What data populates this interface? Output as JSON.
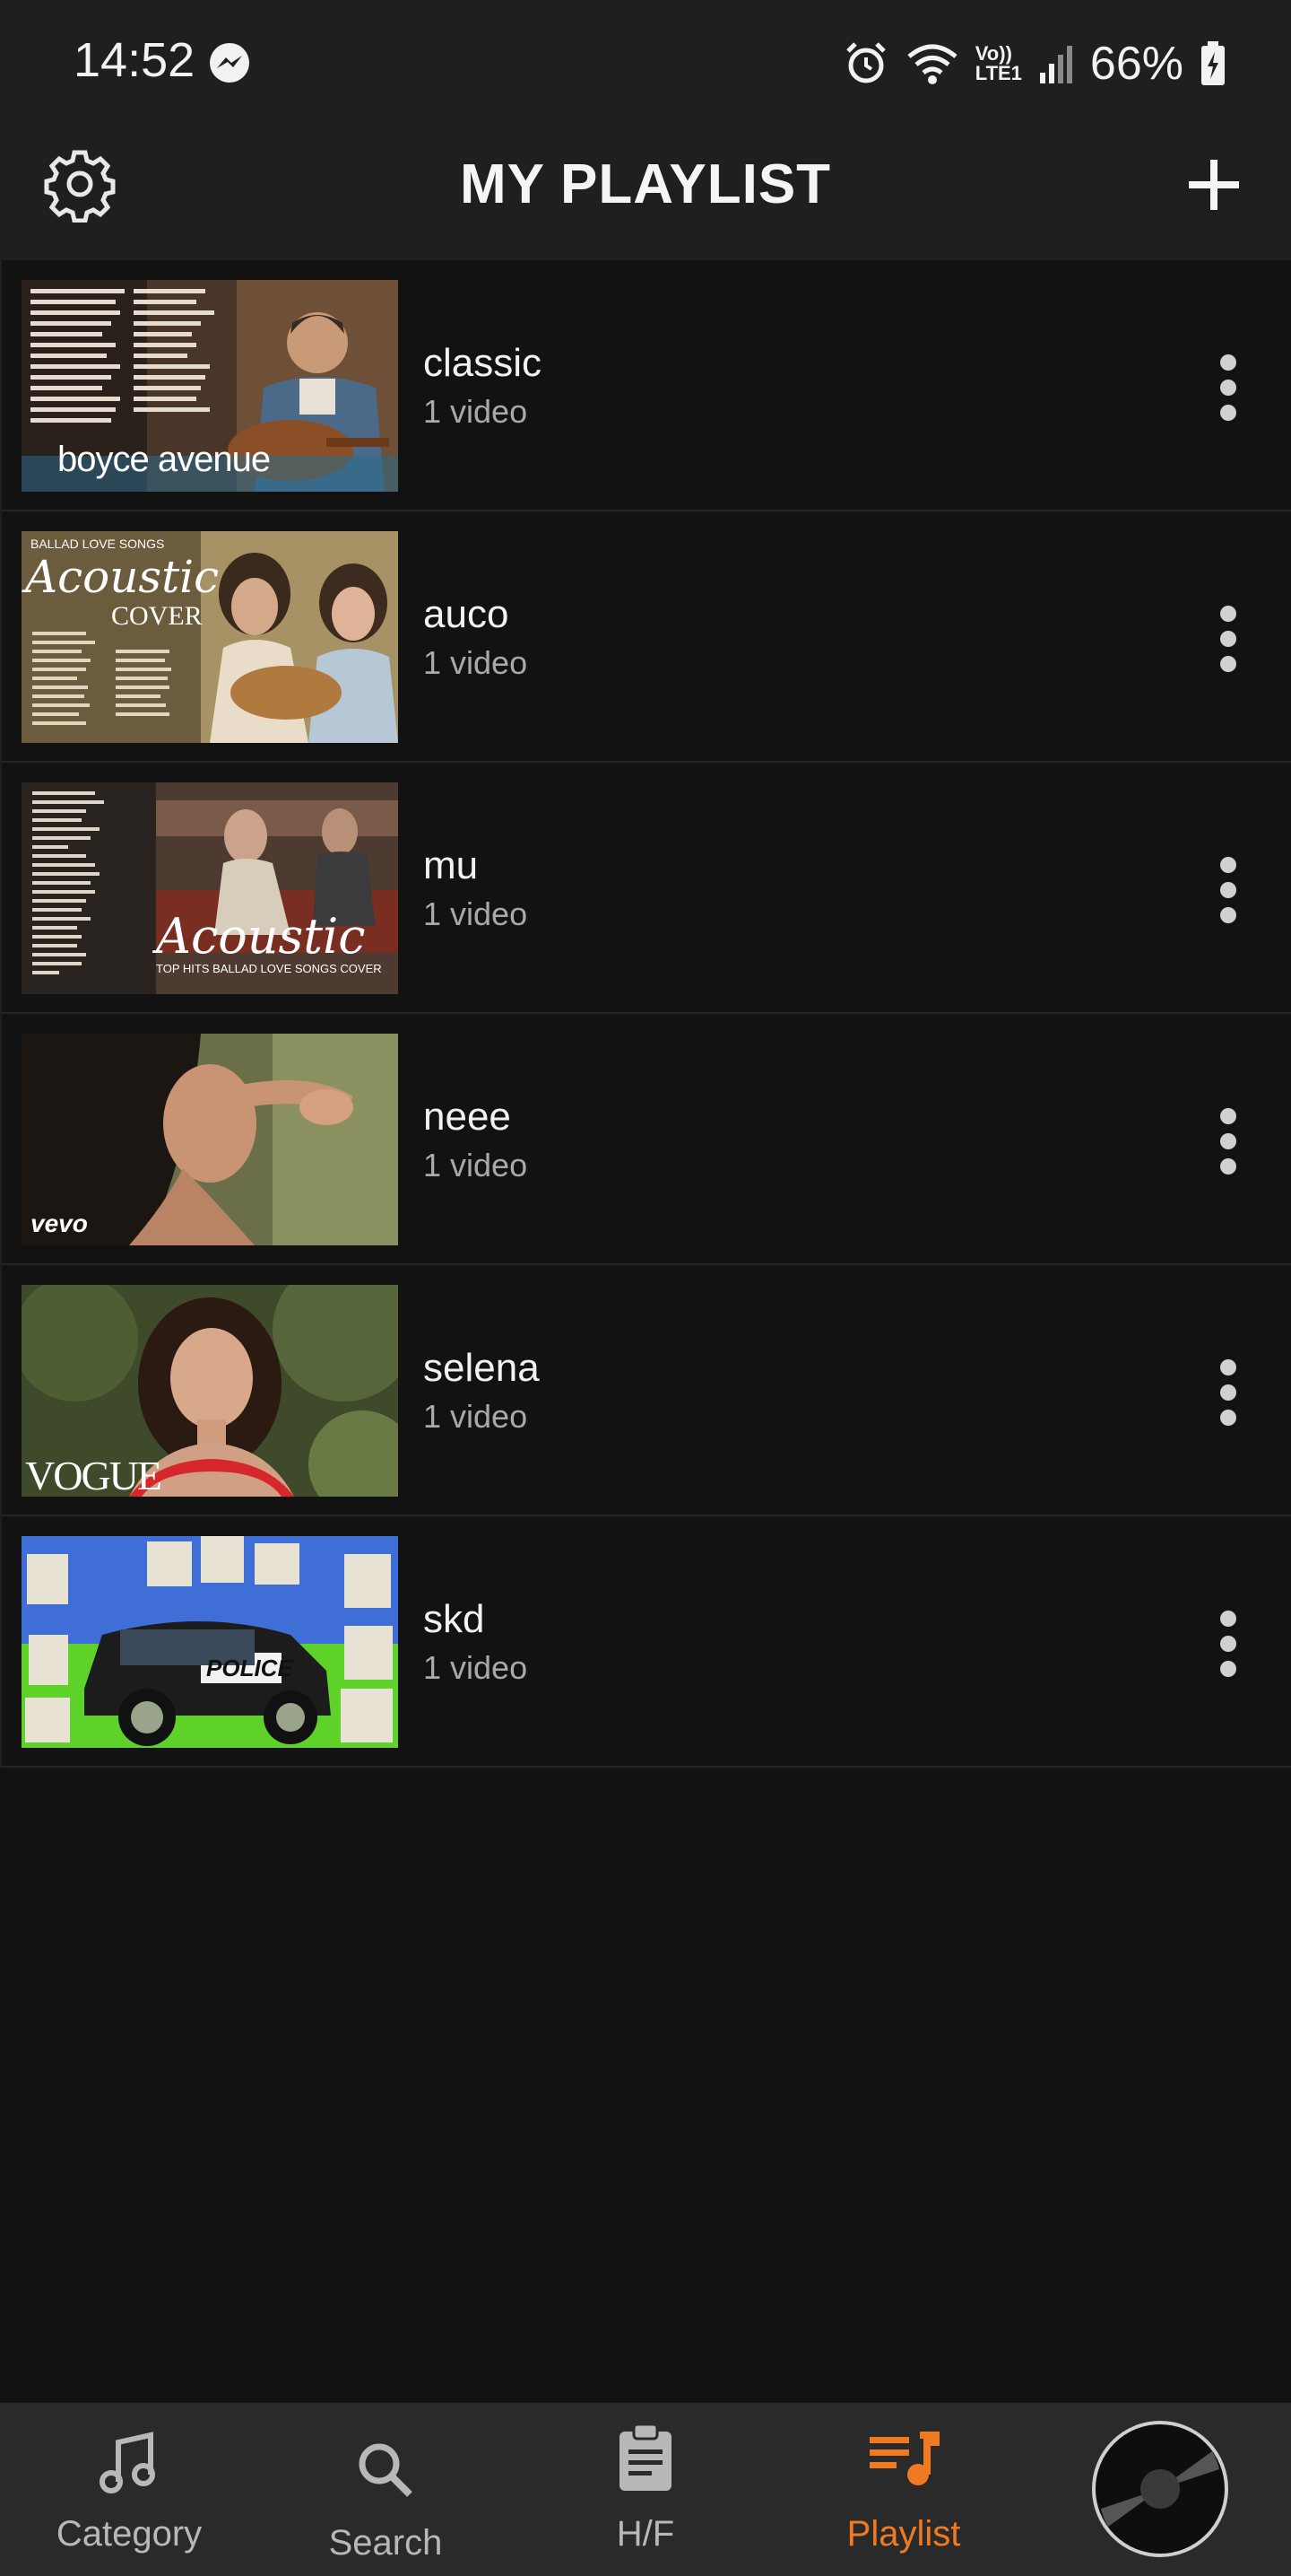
{
  "status_bar": {
    "time": "14:52",
    "battery": "66%",
    "network_label_top": "Vo))",
    "network_label_bottom": "LTE1"
  },
  "header": {
    "title": "MY PLAYLIST"
  },
  "playlists": [
    {
      "name": "classic",
      "count": "1 video",
      "thumb_text": "boyce avenue"
    },
    {
      "name": "auco",
      "count": "1 video",
      "thumb_text_top": "BALLAD LOVE SONGS",
      "thumb_text_main": "Acoustic",
      "thumb_text_sub": "COVER"
    },
    {
      "name": "mu",
      "count": "1 video",
      "thumb_text_main": "Acoustic",
      "thumb_text_sub": "TOP HITS BALLAD LOVE SONGS COVER"
    },
    {
      "name": "neee",
      "count": "1 video",
      "thumb_text": "vevo"
    },
    {
      "name": "selena",
      "count": "1 video",
      "thumb_text": "VOGUE"
    },
    {
      "name": "skd",
      "count": "1 video",
      "thumb_text": "POLICE"
    }
  ],
  "bottom_nav": {
    "items": [
      {
        "label": "Category",
        "icon": "music-note-icon"
      },
      {
        "label": "Search",
        "icon": "search-icon"
      },
      {
        "label": "H/F",
        "icon": "clipboard-icon"
      },
      {
        "label": "Playlist",
        "icon": "playlist-icon",
        "active": true
      }
    ],
    "active_color": "#f07a22"
  }
}
